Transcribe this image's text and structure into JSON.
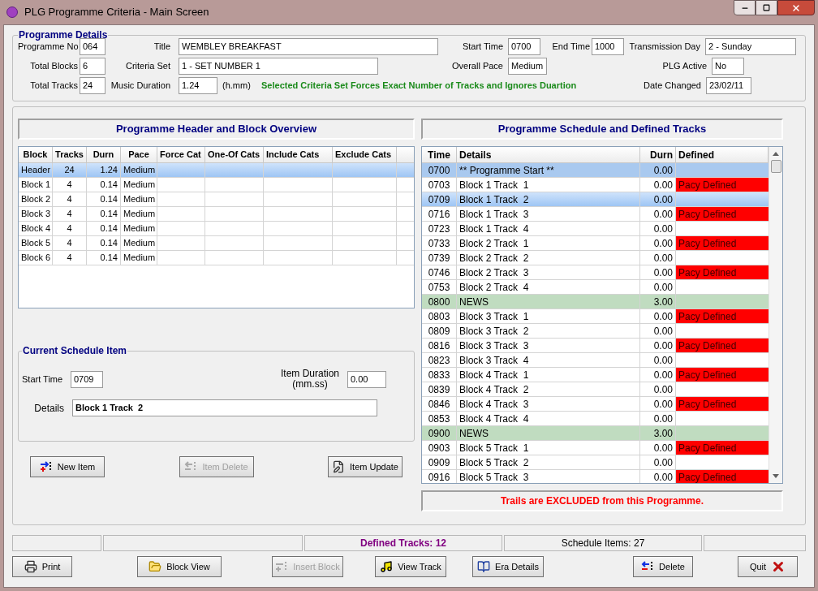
{
  "window": {
    "title": "PLG Programme Criteria - Main Screen"
  },
  "programme_details": {
    "title": "Programme Details",
    "programme_no": {
      "label": "Programme No",
      "value": "064"
    },
    "title_field": {
      "label": "Title",
      "value": "WEMBLEY BREAKFAST"
    },
    "start_time": {
      "label": "Start Time",
      "value": "0700"
    },
    "end_time": {
      "label": "End Time",
      "value": "1000"
    },
    "transmission_day": {
      "label": "Transmission Day",
      "value": "2 - Sunday"
    },
    "total_blocks": {
      "label": "Total Blocks",
      "value": "6"
    },
    "criteria_set": {
      "label": "Criteria Set",
      "value": "1 - SET NUMBER 1"
    },
    "overall_pace": {
      "label": "Overall Pace",
      "value": "Medium"
    },
    "plg_active": {
      "label": "PLG Active",
      "value": "No"
    },
    "total_tracks": {
      "label": "Total Tracks",
      "value": "24"
    },
    "music_duration": {
      "label": "Music Duration",
      "value": "1.24",
      "unit": "(h.mm)"
    },
    "message": "Selected Criteria Set Forces Exact Number of Tracks and Ignores Duartion",
    "date_changed": {
      "label": "Date Changed",
      "value": "23/02/11"
    }
  },
  "block_overview": {
    "heading": "Programme Header and Block Overview",
    "columns": [
      "Block",
      "Tracks",
      "Durn",
      "Pace",
      "Force Cat",
      "One-Of Cats",
      "Include Cats",
      "Exclude Cats"
    ],
    "rows": [
      {
        "block": "Header",
        "tracks": "24",
        "durn": "1.24",
        "pace": "Medium",
        "selected": true
      },
      {
        "block": "Block 1",
        "tracks": "4",
        "durn": "0.14",
        "pace": "Medium",
        "selected": false
      },
      {
        "block": "Block 2",
        "tracks": "4",
        "durn": "0.14",
        "pace": "Medium",
        "selected": false
      },
      {
        "block": "Block 3",
        "tracks": "4",
        "durn": "0.14",
        "pace": "Medium",
        "selected": false
      },
      {
        "block": "Block 4",
        "tracks": "4",
        "durn": "0.14",
        "pace": "Medium",
        "selected": false
      },
      {
        "block": "Block 5",
        "tracks": "4",
        "durn": "0.14",
        "pace": "Medium",
        "selected": false
      },
      {
        "block": "Block 6",
        "tracks": "4",
        "durn": "0.14",
        "pace": "Medium",
        "selected": false
      }
    ]
  },
  "current_item": {
    "title": "Current Schedule Item",
    "start_time": {
      "label": "Start Time",
      "value": "0709"
    },
    "item_duration": {
      "label": "Item Duration",
      "sublabel": "(mm.ss)",
      "value": "0.00"
    },
    "details": {
      "label": "Details",
      "value": "Block 1 Track  2"
    },
    "buttons": [
      {
        "label": "New Item",
        "disabled": false
      },
      {
        "label": "Item Delete",
        "disabled": true
      },
      {
        "label": "Item Update",
        "disabled": false
      }
    ]
  },
  "schedule": {
    "heading": "Programme Schedule and Defined Tracks",
    "columns": [
      "Time",
      "Details",
      "Durn",
      "Defined"
    ],
    "rows": [
      {
        "time": "0700",
        "details": "** Programme Start **",
        "durn": "0.00",
        "kind": "start",
        "selected": false
      },
      {
        "time": "0703",
        "details": "Block 1 Track  1",
        "durn": "0.00",
        "kind": "track",
        "selected": false,
        "defined": "Pacy Defined"
      },
      {
        "time": "0709",
        "details": "Block 1 Track  2",
        "durn": "0.00",
        "kind": "track",
        "selected": true
      },
      {
        "time": "0716",
        "details": "Block 1 Track  3",
        "durn": "0.00",
        "kind": "track",
        "selected": false,
        "defined": "Pacy Defined"
      },
      {
        "time": "0723",
        "details": "Block 1 Track  4",
        "durn": "0.00",
        "kind": "track",
        "selected": false
      },
      {
        "time": "0733",
        "details": "Block 2 Track  1",
        "durn": "0.00",
        "kind": "track",
        "selected": false,
        "defined": "Pacy Defined"
      },
      {
        "time": "0739",
        "details": "Block 2 Track  2",
        "durn": "0.00",
        "kind": "track",
        "selected": false
      },
      {
        "time": "0746",
        "details": "Block 2 Track  3",
        "durn": "0.00",
        "kind": "track",
        "selected": false,
        "defined": "Pacy Defined"
      },
      {
        "time": "0753",
        "details": "Block 2 Track  4",
        "durn": "0.00",
        "kind": "track",
        "selected": false
      },
      {
        "time": "0800",
        "details": "NEWS",
        "durn": "3.00",
        "kind": "news",
        "selected": false
      },
      {
        "time": "0803",
        "details": "Block 3 Track  1",
        "durn": "0.00",
        "kind": "track",
        "selected": false,
        "defined": "Pacy Defined"
      },
      {
        "time": "0809",
        "details": "Block 3 Track  2",
        "durn": "0.00",
        "kind": "track",
        "selected": false
      },
      {
        "time": "0816",
        "details": "Block 3 Track  3",
        "durn": "0.00",
        "kind": "track",
        "selected": false,
        "defined": "Pacy Defined"
      },
      {
        "time": "0823",
        "details": "Block 3 Track  4",
        "durn": "0.00",
        "kind": "track",
        "selected": false
      },
      {
        "time": "0833",
        "details": "Block 4 Track  1",
        "durn": "0.00",
        "kind": "track",
        "selected": false,
        "defined": "Pacy Defined"
      },
      {
        "time": "0839",
        "details": "Block 4 Track  2",
        "durn": "0.00",
        "kind": "track",
        "selected": false
      },
      {
        "time": "0846",
        "details": "Block 4 Track  3",
        "durn": "0.00",
        "kind": "track",
        "selected": false,
        "defined": "Pacy Defined"
      },
      {
        "time": "0853",
        "details": "Block 4 Track  4",
        "durn": "0.00",
        "kind": "track",
        "selected": false
      },
      {
        "time": "0900",
        "details": "NEWS",
        "durn": "3.00",
        "kind": "news",
        "selected": false
      },
      {
        "time": "0903",
        "details": "Block 5 Track  1",
        "durn": "0.00",
        "kind": "track",
        "selected": false,
        "defined": "Pacy Defined"
      },
      {
        "time": "0909",
        "details": "Block 5 Track  2",
        "durn": "0.00",
        "kind": "track",
        "selected": false
      },
      {
        "time": "0916",
        "details": "Block 5 Track  3",
        "durn": "0.00",
        "kind": "track",
        "selected": false,
        "defined": "Pacy Defined"
      }
    ],
    "note": "Trails are EXCLUDED from this Programme."
  },
  "status_bar": {
    "defined_tracks": "Defined Tracks: 12",
    "schedule_items": "Schedule Items: 27"
  },
  "buttons": [
    {
      "label": "Print",
      "disabled": false
    },
    {
      "label": "Block View",
      "disabled": false
    },
    {
      "label": "Insert Block",
      "disabled": true
    },
    {
      "label": "View Track",
      "disabled": false
    },
    {
      "label": "Era Details",
      "disabled": false
    },
    {
      "label": "Delete",
      "disabled": false
    },
    {
      "label": "Quit",
      "disabled": false
    }
  ]
}
